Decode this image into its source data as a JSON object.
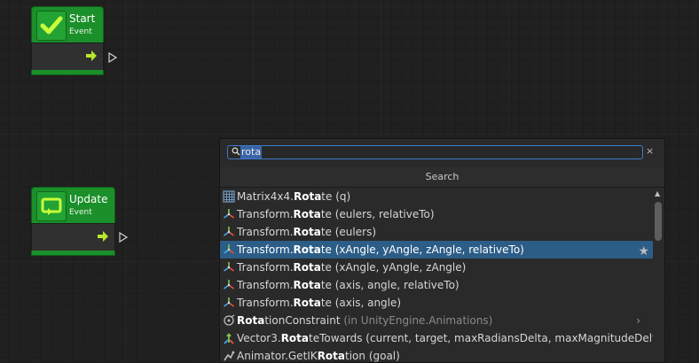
{
  "nodes": {
    "start": {
      "title": "Start",
      "subtitle": "Event"
    },
    "update": {
      "title": "Update",
      "subtitle": "Event"
    }
  },
  "search": {
    "query": "rota",
    "header": "Search",
    "clear": "×"
  },
  "results": [
    {
      "type": "Matrix4x4.",
      "match": "Rota",
      "rest": "te (q)",
      "icon": "matrix-icon"
    },
    {
      "type": "Transform.",
      "match": "Rota",
      "rest": "te (eulers, relativeTo)",
      "icon": "transform-icon"
    },
    {
      "type": "Transform.",
      "match": "Rota",
      "rest": "te (eulers)",
      "icon": "transform-icon"
    },
    {
      "type": "Transform.",
      "match": "Rota",
      "rest": "te (xAngle, yAngle, zAngle, relativeTo)",
      "icon": "transform-icon",
      "selected": true
    },
    {
      "type": "Transform.",
      "match": "Rota",
      "rest": "te (xAngle, yAngle, zAngle)",
      "icon": "transform-icon"
    },
    {
      "type": "Transform.",
      "match": "Rota",
      "rest": "te (axis, angle, relativeTo)",
      "icon": "transform-icon"
    },
    {
      "type": "Transform.",
      "match": "Rota",
      "rest": "te (axis, angle)",
      "icon": "transform-icon"
    },
    {
      "type": "",
      "match": "Rota",
      "rest": "tionConstraint ",
      "hint": "(in UnityEngine.Animations)",
      "icon": "constraint-icon",
      "chevron": "›"
    },
    {
      "type": "Vector3.",
      "match": "Rota",
      "rest": "teTowards (current, target, maxRadiansDelta, maxMagnitudeDelta)",
      "icon": "vector-icon"
    },
    {
      "type": "Animator.GetIK",
      "match": "Rota",
      "rest": "tion (goal)",
      "icon": "animator-icon"
    }
  ],
  "colors": {
    "canvas": "#202020",
    "node_green": "#1b8f2a",
    "selection": "#2c5d87",
    "focus_border": "#3e7bcf"
  }
}
